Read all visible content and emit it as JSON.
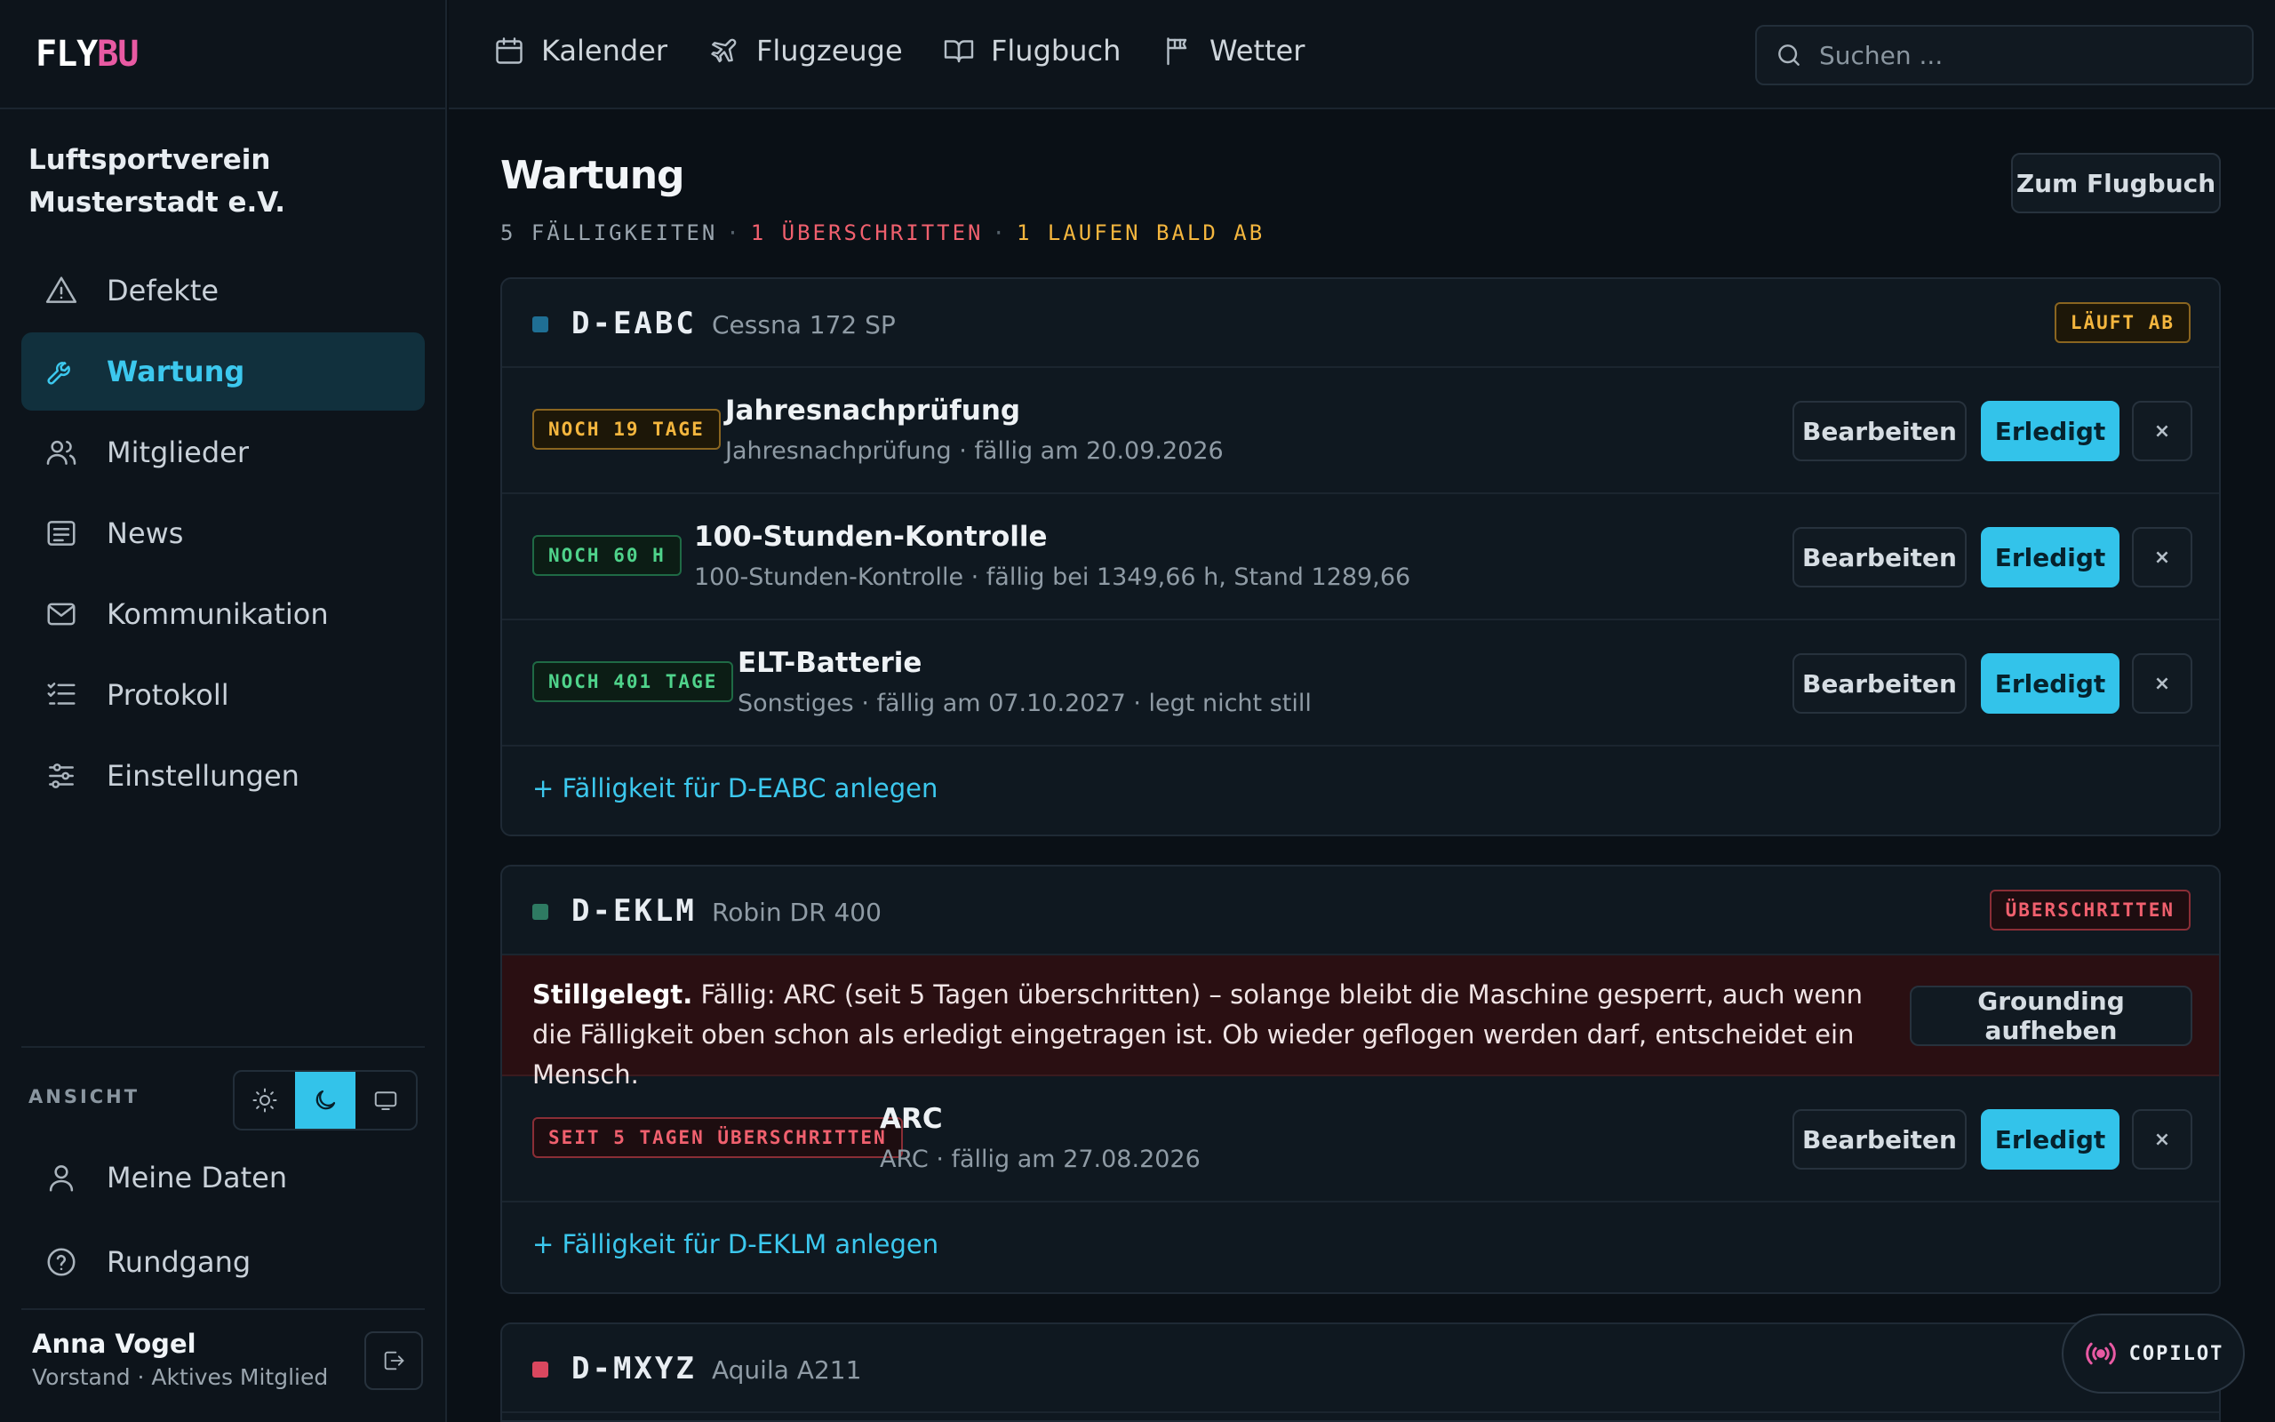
{
  "logo": {
    "part1": "FLY",
    "part2": "BU"
  },
  "club": {
    "name": "Luftsportverein Musterstadt e.V."
  },
  "sidebar": {
    "items": [
      {
        "label": "Defekte",
        "icon": "warning-icon"
      },
      {
        "label": "Wartung",
        "icon": "wrench-icon",
        "active": true
      },
      {
        "label": "Mitglieder",
        "icon": "users-icon"
      },
      {
        "label": "News",
        "icon": "news-icon"
      },
      {
        "label": "Kommunikation",
        "icon": "mail-icon"
      },
      {
        "label": "Protokoll",
        "icon": "list-check-icon"
      },
      {
        "label": "Einstellungen",
        "icon": "sliders-icon"
      }
    ],
    "view_label": "ANSICHT",
    "theme_options": [
      "sun-icon",
      "moon-icon",
      "monitor-icon"
    ],
    "theme_selected": "moon-icon",
    "bottom_items": [
      {
        "label": "Meine Daten",
        "icon": "user-icon"
      },
      {
        "label": "Rundgang",
        "icon": "help-circle-icon"
      }
    ],
    "user": {
      "name": "Anna Vogel",
      "role": "Vorstand · Aktives Mitglied"
    }
  },
  "topbar": {
    "links": [
      {
        "label": "Kalender",
        "icon": "calendar-icon"
      },
      {
        "label": "Flugzeuge",
        "icon": "plane-icon"
      },
      {
        "label": "Flugbuch",
        "icon": "book-icon"
      },
      {
        "label": "Wetter",
        "icon": "windsock-icon"
      }
    ],
    "search_placeholder": "Suchen ..."
  },
  "page": {
    "title": "Wartung",
    "summary": {
      "total": "5 FÄLLIGKEITEN",
      "overdue": "1 ÜBERSCHRITTEN",
      "expiring": "1 LAUFEN BALD AB"
    },
    "logbook_button": "Zum Flugbuch"
  },
  "labels": {
    "edit": "Bearbeiten",
    "done": "Erledigt",
    "delete": "×"
  },
  "aircraft": [
    {
      "registration": "D-EABC",
      "type": "Cessna 172 SP",
      "color": "#1f6f94",
      "status": "LÄUFT AB",
      "status_kind": "amber",
      "items": [
        {
          "badge": "NOCH 19 TAGE",
          "badge_kind": "amber",
          "title": "Jahresnachprüfung",
          "detail": "Jahresnachprüfung · fällig am 20.09.2026"
        },
        {
          "badge": "NOCH 60 H",
          "badge_kind": "green",
          "title": "100-Stunden-Kontrolle",
          "detail": "100-Stunden-Kontrolle · fällig bei 1349,66 h, Stand 1289,66"
        },
        {
          "badge": "NOCH 401 TAGE",
          "badge_kind": "green",
          "title": "ELT-Batterie",
          "detail": "Sonstiges · fällig am 07.10.2027 · legt nicht still"
        }
      ],
      "add_label": "+ Fälligkeit für D-EABC anlegen"
    },
    {
      "registration": "D-EKLM",
      "type": "Robin DR 400",
      "color": "#2e7a62",
      "status": "ÜBERSCHRITTEN",
      "status_kind": "red",
      "grounding": {
        "strong": "Stillgelegt.",
        "text": " Fällig: ARC (seit 5 Tagen überschritten) – solange bleibt die Maschine gesperrt, auch wenn die Fälligkeit oben schon als erledigt eingetragen ist. Ob wieder geflogen werden darf, entscheidet ein Mensch.",
        "button": "Grounding aufheben"
      },
      "items": [
        {
          "badge": "SEIT 5 TAGEN ÜBERSCHRITTEN",
          "badge_kind": "red",
          "title": "ARC",
          "detail": "ARC · fällig am 27.08.2026"
        }
      ],
      "add_label": "+ Fälligkeit für D-EKLM anlegen"
    },
    {
      "registration": "D-MXYZ",
      "type": "Aquila A211",
      "color": "#d9475f"
    }
  ],
  "copilot": {
    "label": "COPILOT",
    "icon": "broadcast-icon"
  }
}
